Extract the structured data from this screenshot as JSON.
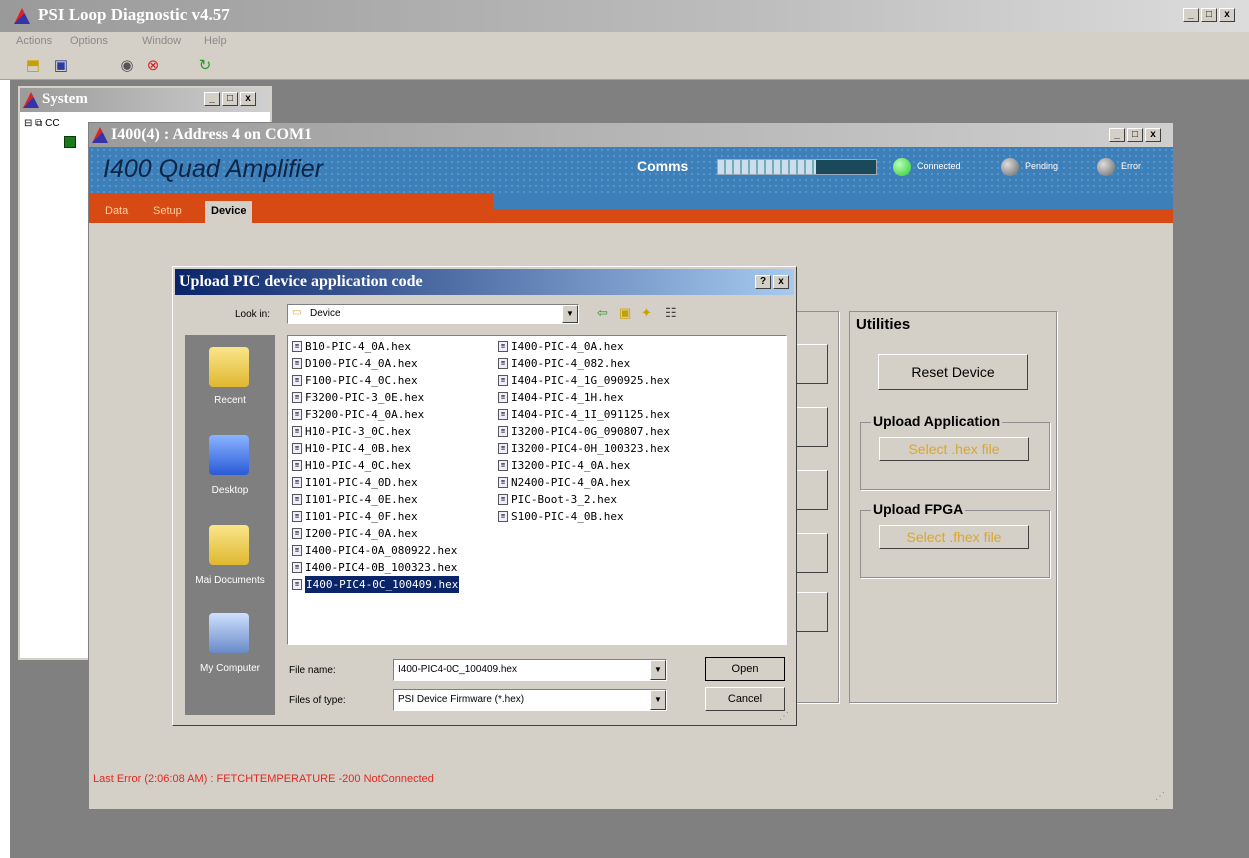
{
  "app": {
    "title": "PSI Loop Diagnostic v4.57",
    "menu": [
      "Actions",
      "Options",
      "Window",
      "Help"
    ]
  },
  "system_window": {
    "title": "System",
    "tree_root": "CC"
  },
  "device_window": {
    "title": "I400(4) : Address 4 on COM1",
    "device_name": "I400 Quad Amplifier",
    "comms_label": "Comms",
    "indicators": {
      "connected": "Connected",
      "pending": "Pending",
      "error": "Error"
    },
    "tabs": [
      "Data",
      "Setup",
      "Device"
    ],
    "active_tab": "Device",
    "utilities": {
      "title": "Utilities",
      "reset_label": "Reset Device",
      "upload_app_title": "Upload Application",
      "upload_app_button": "Select .hex file",
      "upload_fpga_title": "Upload FPGA",
      "upload_fpga_button": "Select .fhex file"
    },
    "last_error": "Last Error (2:06:08 AM) :  FETCHTEMPERATURE -200 NotConnected"
  },
  "dialog": {
    "title": "Upload PIC device application code",
    "look_in_label": "Look in:",
    "look_in_value": "Device",
    "places": [
      "Recent",
      "Desktop",
      "Mai Documents",
      "My Computer"
    ],
    "files_col1": [
      "B10-PIC-4_0A.hex",
      "D100-PIC-4_0A.hex",
      "F100-PIC-4_0C.hex",
      "F3200-PIC-3_0E.hex",
      "F3200-PIC-4_0A.hex",
      "H10-PIC-3_0C.hex",
      "H10-PIC-4_0B.hex",
      "H10-PIC-4_0C.hex",
      "I101-PIC-4_0D.hex",
      "I101-PIC-4_0E.hex",
      "I101-PIC-4_0F.hex",
      "I200-PIC-4_0A.hex",
      "I400-PIC4-0A_080922.hex",
      "I400-PIC4-0B_100323.hex",
      "I400-PIC4-0C_100409.hex"
    ],
    "files_col2": [
      "I400-PIC-4_0A.hex",
      "I400-PIC-4_082.hex",
      "I404-PIC-4_1G_090925.hex",
      "I404-PIC-4_1H.hex",
      "I404-PIC-4_1I_091125.hex",
      "I3200-PIC4-0G_090807.hex",
      "I3200-PIC4-0H_100323.hex",
      "I3200-PIC-4_0A.hex",
      "N2400-PIC-4_0A.hex",
      "PIC-Boot-3_2.hex",
      "S100-PIC-4_0B.hex"
    ],
    "selected_file": "I400-PIC4-0C_100409.hex",
    "file_name_label": "File name:",
    "file_name_value": "I400-PIC4-0C_100409.hex",
    "file_type_label": "Files of type:",
    "file_type_value": "PSI Device Firmware (*.hex)",
    "open_label": "Open",
    "cancel_label": "Cancel"
  },
  "colors": {
    "banner": "#3d7fb8",
    "tab_bar": "#d84a14",
    "dialog_title": "#0a246a",
    "error_text": "#e2281f",
    "connected_led": "#2ec92e"
  }
}
